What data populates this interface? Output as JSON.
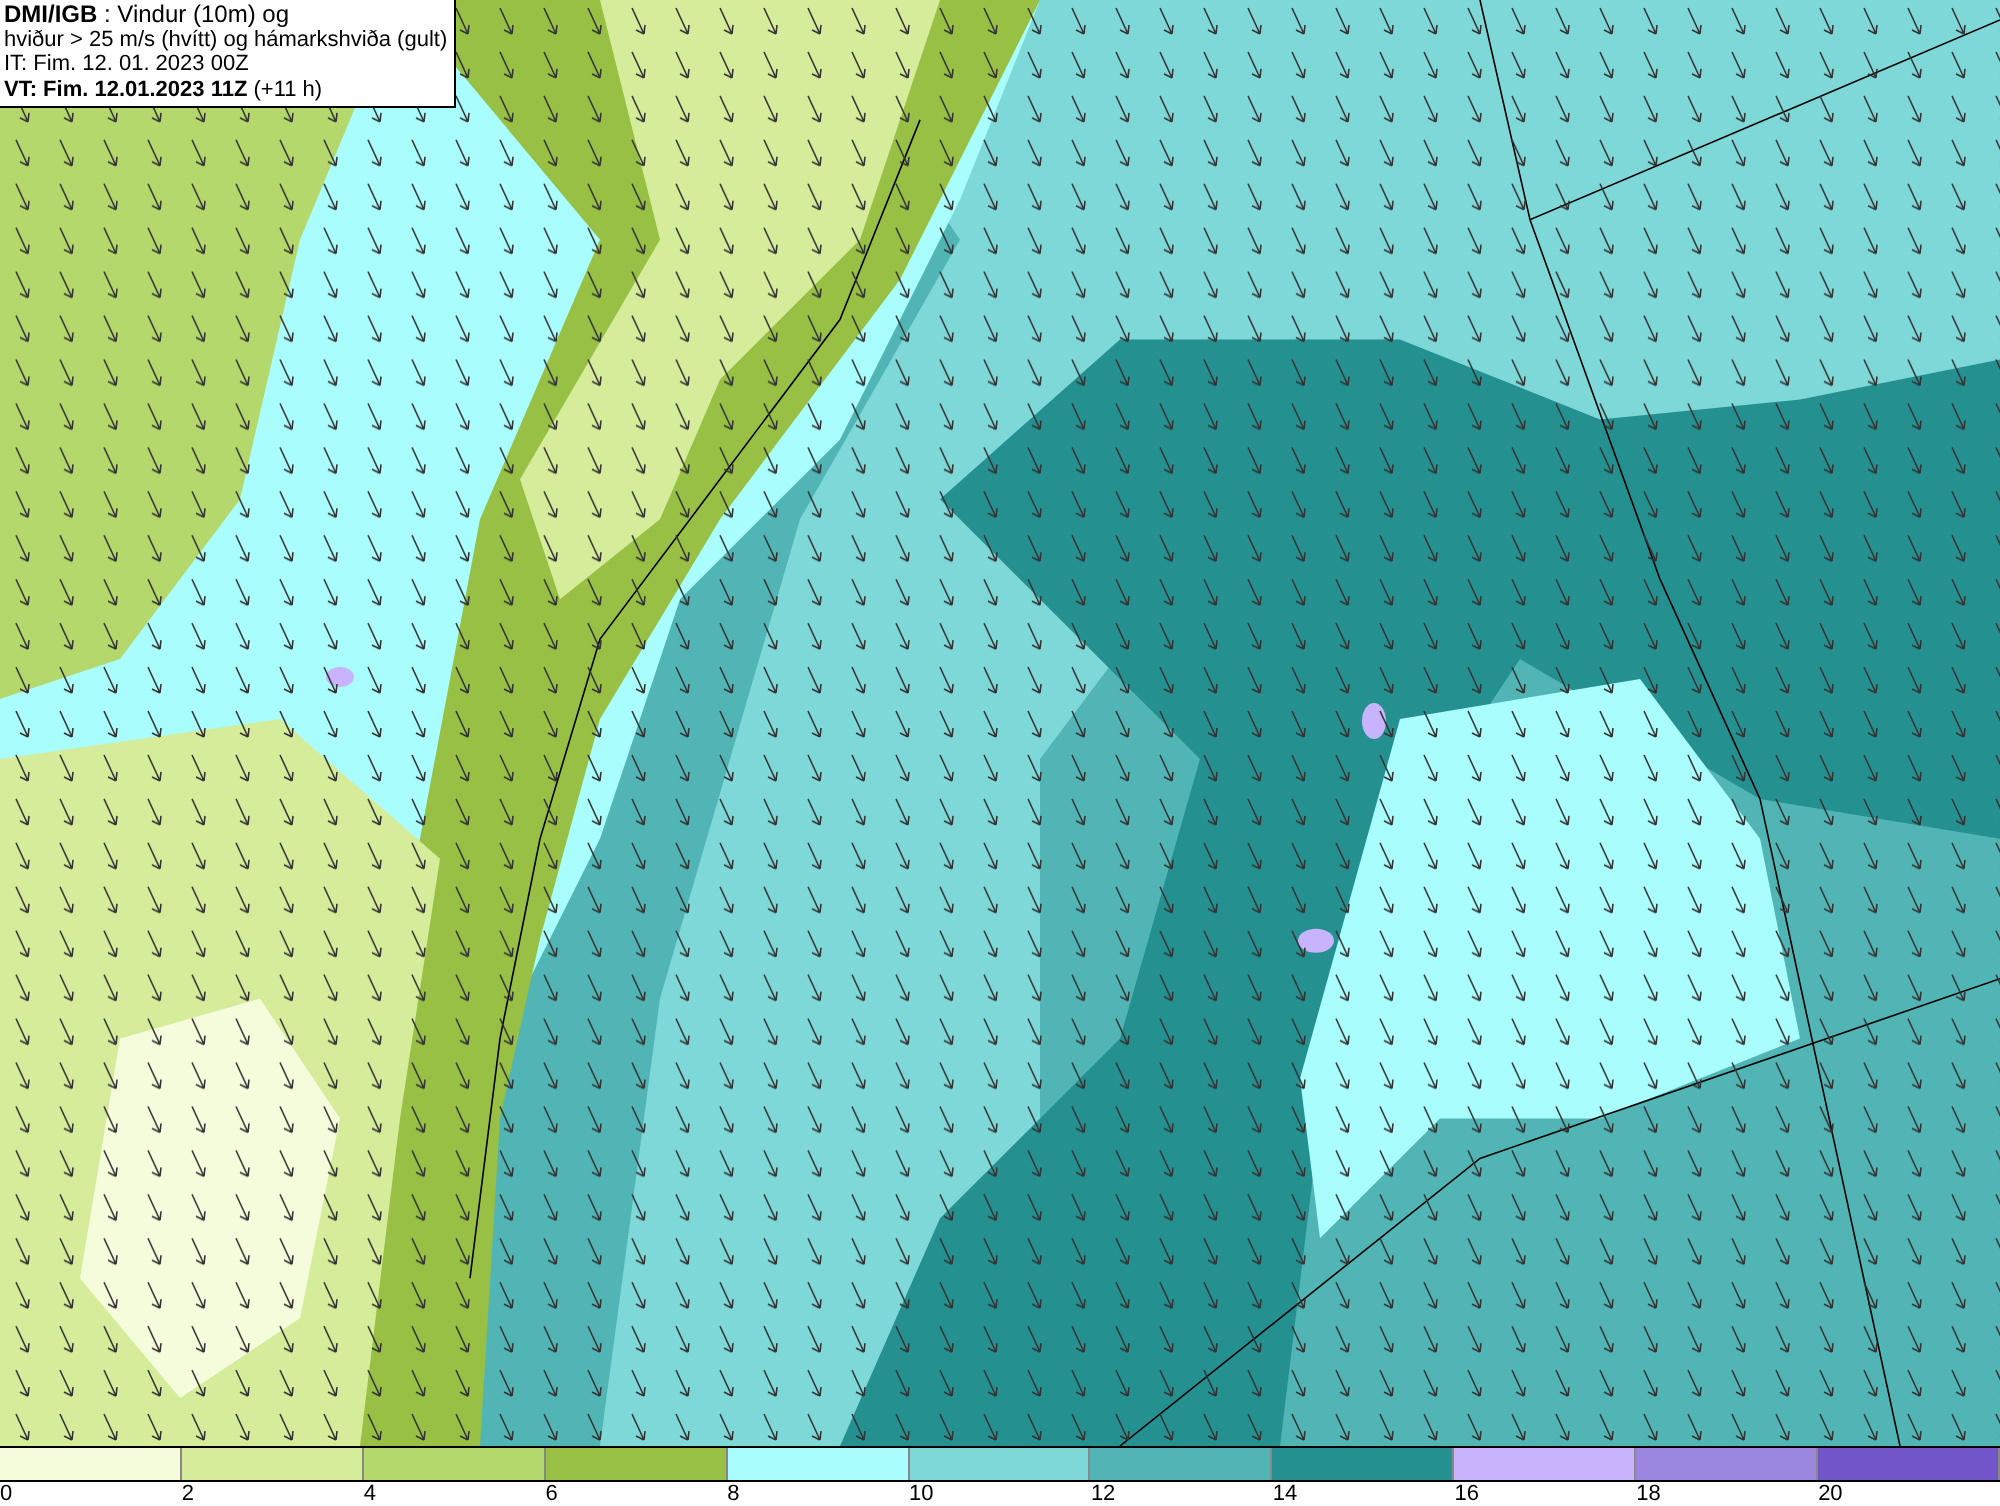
{
  "header": {
    "lines": [
      "**DMI/IGB** : Vindur (10m) og",
      "hviður > 25 m/s (hvítt) og hámarkshviða (gult)",
      "IT: Fim. 12. 01. 2023 00Z",
      "**VT: Fim. 12.01.2023 11Z** (+11 h)"
    ]
  },
  "legend": {
    "segments": [
      {
        "label": "0",
        "color": "#f5fcdc"
      },
      {
        "label": "2",
        "color": "#d5ec9a"
      },
      {
        "label": "4",
        "color": "#b4d86c"
      },
      {
        "label": "6",
        "color": "#97c045"
      },
      {
        "label": "8",
        "color": "#aafdfd"
      },
      {
        "label": "10",
        "color": "#7fd8d8"
      },
      {
        "label": "12",
        "color": "#52b5b5"
      },
      {
        "label": "14",
        "color": "#249090"
      },
      {
        "label": "16",
        "color": "#c8b4fc"
      },
      {
        "label": "18",
        "color": "#9b86e0"
      },
      {
        "label": "20",
        "color": "#7255c8"
      }
    ]
  }
}
